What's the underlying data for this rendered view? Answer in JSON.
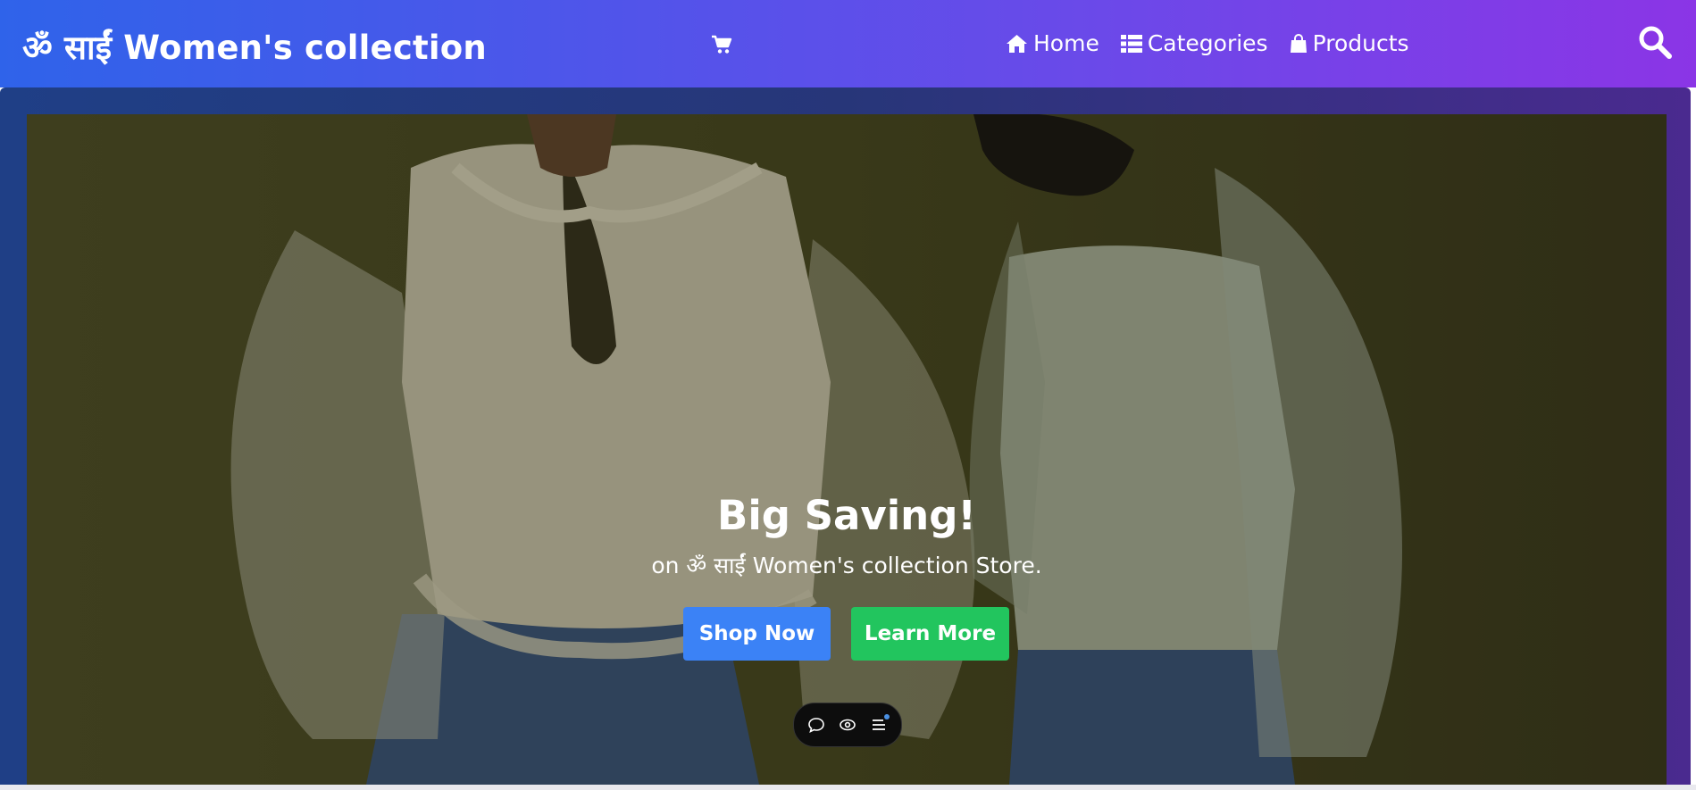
{
  "header": {
    "brand": "ॐ साईं Women's collection",
    "cart_icon": "shopping-cart-icon",
    "nav": [
      {
        "icon": "home-icon",
        "label": "Home"
      },
      {
        "icon": "list-icon",
        "label": "Categories"
      },
      {
        "icon": "shopping-bag-icon",
        "label": "Products"
      }
    ],
    "search_icon": "search-icon"
  },
  "hero": {
    "title": "Big Saving!",
    "subtitle": "on ॐ साईं Women's collection Store.",
    "primary_button": "Shop Now",
    "secondary_button": "Learn More"
  },
  "floating_toolbar": {
    "icons": [
      "chat-bubble-icon",
      "eye-icon",
      "menu-icon"
    ]
  },
  "colors": {
    "header_gradient_start": "#2f63ea",
    "header_gradient_end": "#8b35e6",
    "shop_button": "#3b82f6",
    "learn_button": "#22c55e"
  }
}
